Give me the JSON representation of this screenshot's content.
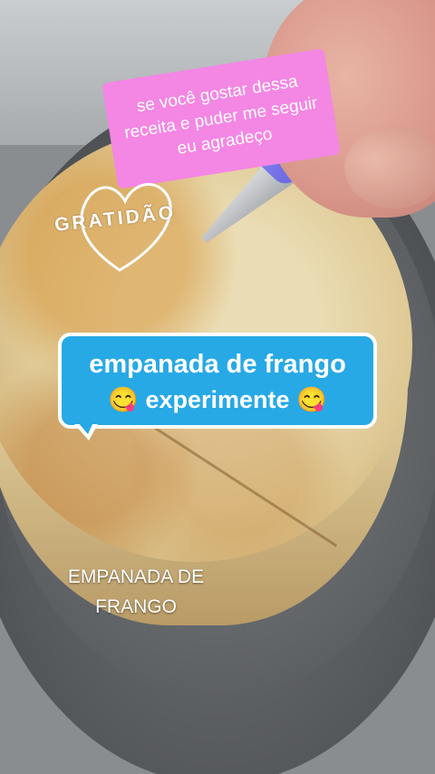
{
  "overlays": {
    "note_sticker": "se você gostar dessa receita e puder me seguir eu agradeço",
    "gratitude_sticker": "GRATIDÃO",
    "title_bubble": {
      "line1": "empanada de frango",
      "line2": "😋 experimente 😋"
    },
    "caption": "EMPANADA DE FRANGO"
  },
  "colors": {
    "note_sticker_bg": "#f486e4",
    "title_bubble_bg": "#27a9e6",
    "knife_handle": "#7b79ec"
  }
}
